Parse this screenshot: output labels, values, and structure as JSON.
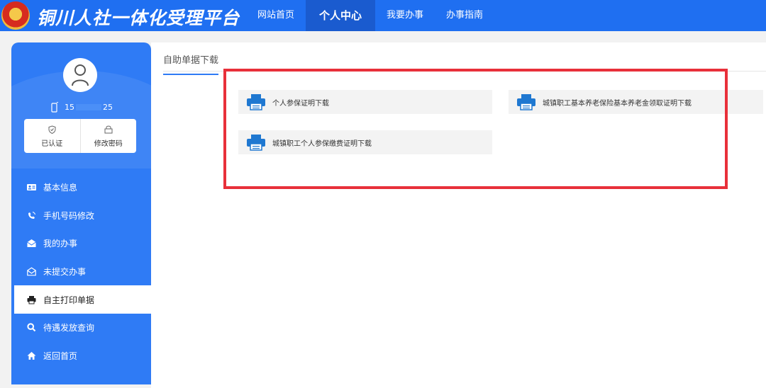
{
  "header": {
    "site_title": "铜川人社一体化受理平台",
    "nav": [
      {
        "label": "网站首页",
        "active": false
      },
      {
        "label": "个人中心",
        "active": true
      },
      {
        "label": "我要办事",
        "active": false
      },
      {
        "label": "办事指南",
        "active": false
      }
    ]
  },
  "profile": {
    "phone_prefix": "15",
    "phone_suffix": "25",
    "actions": [
      {
        "label": "已认证",
        "icon": "shield-check-icon"
      },
      {
        "label": "修改密码",
        "icon": "lock-icon"
      }
    ]
  },
  "sidebar": {
    "items": [
      {
        "label": "基本信息",
        "icon": "id-card-icon"
      },
      {
        "label": "手机号码修改",
        "icon": "phone-signal-icon"
      },
      {
        "label": "我的办事",
        "icon": "envelope-open-icon"
      },
      {
        "label": "未提交办事",
        "icon": "envelope-outline-icon"
      },
      {
        "label": "自主打印单据",
        "icon": "printer-icon",
        "active": true
      },
      {
        "label": "待遇发放查询",
        "icon": "search-icon"
      },
      {
        "label": "返回首页",
        "icon": "home-icon"
      }
    ]
  },
  "main": {
    "tab_label": "自助单据下载",
    "downloads": [
      {
        "label": "个人参保证明下载",
        "icon": "printer-icon"
      },
      {
        "label": "城镇职工基本养老保险基本养老金领取证明下载",
        "icon": "printer-icon"
      },
      {
        "label": "城镇职工个人参保缴费证明下载",
        "icon": "printer-icon"
      }
    ]
  },
  "colors": {
    "primary": "#1f6ff1",
    "sidebar": "#2f7bf5",
    "highlight": "#e8303a",
    "printer_icon": "#1f78d1"
  }
}
